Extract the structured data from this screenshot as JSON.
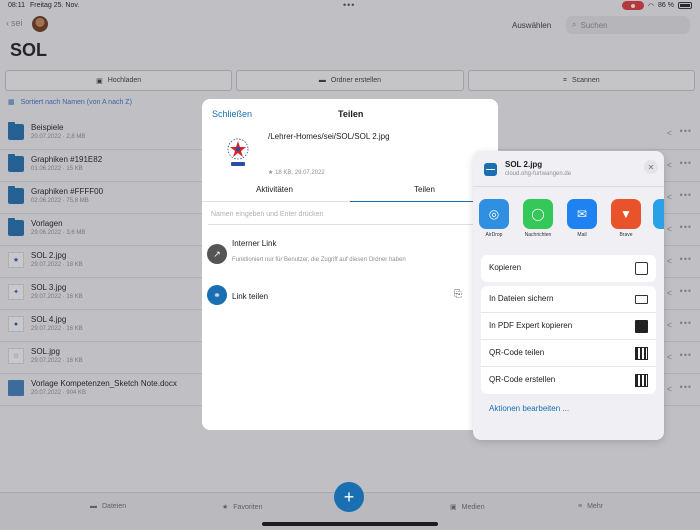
{
  "status": {
    "time": "08:11",
    "date": "Freitag 25. Nov.",
    "battery": "86 %"
  },
  "header": {
    "back_label": "sei",
    "title": "SOL",
    "select_label": "Auswählen",
    "search_placeholder": "Suchen"
  },
  "actions": {
    "upload": "Hochladen",
    "create_folder": "Ordner erstellen",
    "scan": "Scannen"
  },
  "sort_label": "Sortiert nach Namen (von A nach Z)",
  "files": [
    {
      "name": "Beispiele",
      "meta": "20.07.2022 · 2,8 MB",
      "kind": "folder"
    },
    {
      "name": "Graphiken #191E82",
      "meta": "01.06.2022 · 15 KB",
      "kind": "folder"
    },
    {
      "name": "Graphiken #FFFF00",
      "meta": "02.06.2022 · 75,8 MB",
      "kind": "folder"
    },
    {
      "name": "Vorlagen",
      "meta": "29.06.2022 · 3,6 MB",
      "kind": "folder-link"
    },
    {
      "name": "SOL 2.jpg",
      "meta": "29.07.2022 · 18 KB",
      "kind": "image"
    },
    {
      "name": "SOL 3.jpg",
      "meta": "29.07.2022 · 16 KB",
      "kind": "image"
    },
    {
      "name": "SOL 4.jpg",
      "meta": "29.07.2022 · 16 KB",
      "kind": "image"
    },
    {
      "name": "SOL.jpg",
      "meta": "29.07.2022 · 16 KB",
      "kind": "image"
    },
    {
      "name": "Vorlage Kompetenzen_Sketch Note.docx",
      "meta": "20.07.2022 · 904 KB",
      "kind": "doc"
    }
  ],
  "tabbar": {
    "files": "Dateien",
    "favorites": "Favoriten",
    "media": "Medien",
    "more": "Mehr",
    "fab": "+"
  },
  "share_sheet": {
    "close": "Schließen",
    "title": "Teilen",
    "path": "/Lehrer-Homes/sei/SOL/SOL 2.jpg",
    "file_meta": "18 KB, 29.07.2022",
    "tab_activities": "Aktivitäten",
    "tab_share": "Teilen",
    "name_placeholder": "Namen eingeben und Enter drücken",
    "internal_link_title": "Interner Link",
    "internal_link_desc": "Funktioniert nur für Benutzer, die Zugriff auf diesen Ordner haben",
    "share_link": "Link teilen"
  },
  "ios_share": {
    "title": "SOL 2.jpg",
    "subtitle": "cloud.ohg-furtwangen.de",
    "apps": [
      {
        "label": "AirDrop",
        "color": "#2f8fe0"
      },
      {
        "label": "Nachrichten",
        "color": "#34c759"
      },
      {
        "label": "Mail",
        "color": "#1e82f0"
      },
      {
        "label": "Brave",
        "color": "#e8532b"
      },
      {
        "label": "Ne",
        "color": "#2aa0e8"
      }
    ],
    "copy": "Kopieren",
    "save_files": "In Dateien sichern",
    "pdf_expert": "In PDF Expert kopieren",
    "qr_share": "QR-Code teilen",
    "qr_create": "QR-Code erstellen",
    "edit_actions": "Aktionen bearbeiten ..."
  },
  "colors": {
    "accent": "#1a6fb3",
    "folder": "#1d6fb0",
    "record": "#e5373a"
  }
}
